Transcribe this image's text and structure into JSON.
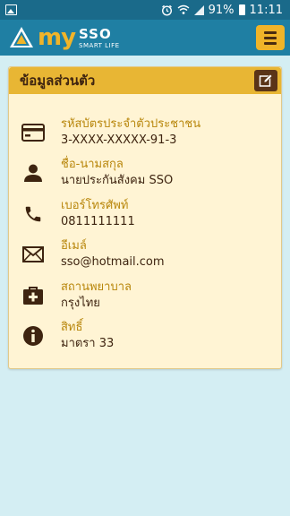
{
  "status_bar": {
    "battery": "91%",
    "time": "11:11"
  },
  "app": {
    "logo_my": "my",
    "logo_sso": "SSO",
    "logo_tagline": "SMART LIFE"
  },
  "card": {
    "title": "ข้อมูลส่วนตัว",
    "rows": [
      {
        "icon": "id-card-icon",
        "label": "รหัสบัตรประจำตัวประชาชน",
        "value": "3-XXXX-XXXXX-91-3"
      },
      {
        "icon": "person-icon",
        "label": "ชื่อ-นามสกุล",
        "value": "นายประกันสังคม SSO"
      },
      {
        "icon": "phone-icon",
        "label": "เบอร์โทรศัพท์",
        "value": "0811111111"
      },
      {
        "icon": "mail-icon",
        "label": "อีเมล์",
        "value": "sso@hotmail.com"
      },
      {
        "icon": "hospital-icon",
        "label": "สถานพยาบาล",
        "value": "กรุงไทย"
      },
      {
        "icon": "info-icon",
        "label": "สิทธิ์",
        "value": "มาตรา 33"
      }
    ]
  },
  "colors": {
    "statusbar": "#1a6a8a",
    "appbar": "#1f7fa3",
    "accent": "#f0b429",
    "card_bg": "#fff4d4",
    "label": "#b8860b",
    "text": "#3e2410"
  }
}
